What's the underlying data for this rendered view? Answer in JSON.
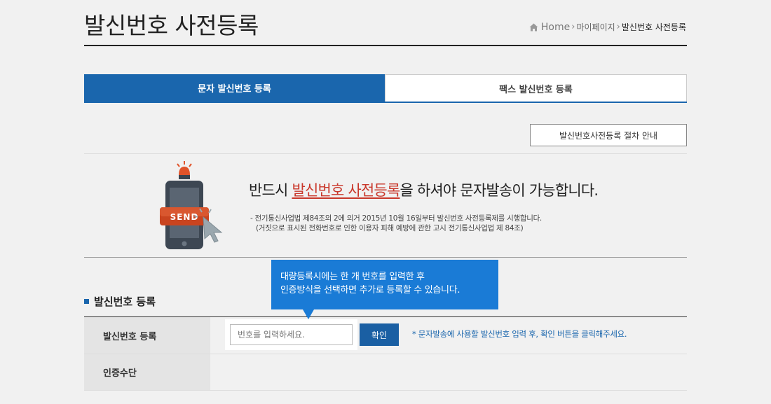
{
  "header": {
    "title": "발신번호 사전등록",
    "breadcrumb": [
      "Home",
      "마이페이지",
      "발신번호 사전등록"
    ]
  },
  "tabs": [
    {
      "label": "문자 발신번호 등록",
      "active": true
    },
    {
      "label": "팩스 발신번호 등록",
      "active": false
    }
  ],
  "guide_button": "발신번호사전등록 절차 안내",
  "notice": {
    "phone_badge": "SEND",
    "headline_pre": "반드시 ",
    "headline_highlight": "발신번호 사전등록",
    "headline_post": "을 하셔야 문자발송이 가능합니다.",
    "detail_line1": "- 전기통신사업법 제84조의 2에 의거 2015년 10월 16일부터 발신번호 사전등록제를 시행합니다.",
    "detail_line2": "(거짓으로 표시된 전화번호로 인한 이용자 피해 예방에 관한 고시 전기통신사업법 제 84조)"
  },
  "tooltip": {
    "line1": "대량등록시에는 한 개 번호를 입력한 후",
    "line2": "인증방식을 선택하면 추가로 등록할 수 있습니다."
  },
  "section": {
    "title": "발신번호 등록"
  },
  "form": {
    "row1_label": "발신번호 등록",
    "input_placeholder": "번호를 입력하세요.",
    "input_value": "",
    "confirm_label": "확인",
    "helper": "* 문자발송에 사용할 발신번호 입력 후, 확인 버튼을 클릭해주세요.",
    "row2_label": "인증수단"
  },
  "colors": {
    "accent": "#1a66ad",
    "tooltip": "#1a7bd6",
    "highlight": "#c9372a",
    "badge": "#c9441f"
  },
  "icons": [
    "home-icon",
    "chevron-right-icon",
    "square-bullet-icon",
    "phone-send-icon",
    "cursor-icon",
    "siren-icon"
  ]
}
